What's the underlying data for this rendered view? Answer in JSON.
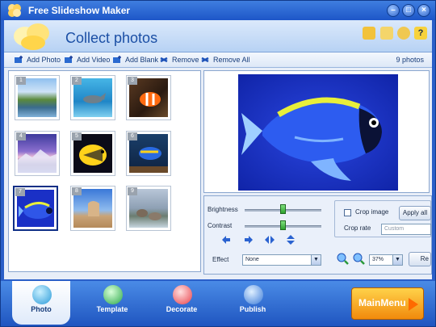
{
  "window": {
    "title": "Free Slideshow Maker"
  },
  "header": {
    "page_title": "Collect photos"
  },
  "toolbar": {
    "add_photo": "Add Photo",
    "add_video": "Add Video",
    "add_blank": "Add Blank",
    "remove": "Remove",
    "remove_all": "Remove All",
    "photo_count": "9 photos"
  },
  "thumbnails": [
    {
      "num": "1",
      "scene": "lake-landscape"
    },
    {
      "num": "2",
      "scene": "dolphin"
    },
    {
      "num": "3",
      "scene": "clownfish"
    },
    {
      "num": "4",
      "scene": "mountain-dusk"
    },
    {
      "num": "5",
      "scene": "yellow-fish"
    },
    {
      "num": "6",
      "scene": "blue-fish-reef"
    },
    {
      "num": "7",
      "scene": "blue-tang",
      "selected": true
    },
    {
      "num": "8",
      "scene": "rock-formation"
    },
    {
      "num": "9",
      "scene": "river-rocks"
    }
  ],
  "controls": {
    "brightness_label": "Brightness",
    "contrast_label": "Contrast",
    "brightness_value": 0.5,
    "contrast_value": 0.5,
    "crop_image_label": "Crop image",
    "apply_all_label": "Apply all",
    "crop_rate_label": "Crop rate",
    "crop_rate_value": "Custom",
    "effect_label": "Effect",
    "effect_value": "None",
    "zoom_value": "37%",
    "reset_label": "Re"
  },
  "tabs": [
    {
      "label": "Photo",
      "icon": "camera-icon",
      "active": true
    },
    {
      "label": "Template",
      "icon": "template-icon",
      "active": false
    },
    {
      "label": "Decorate",
      "icon": "heart-icon",
      "active": false
    },
    {
      "label": "Publish",
      "icon": "publish-icon",
      "active": false
    }
  ],
  "main_menu_label": "MainMenu",
  "colors": {
    "accent": "#1f55c0",
    "title_bar": "#2a62d0",
    "main_menu": "#f5a21a"
  }
}
